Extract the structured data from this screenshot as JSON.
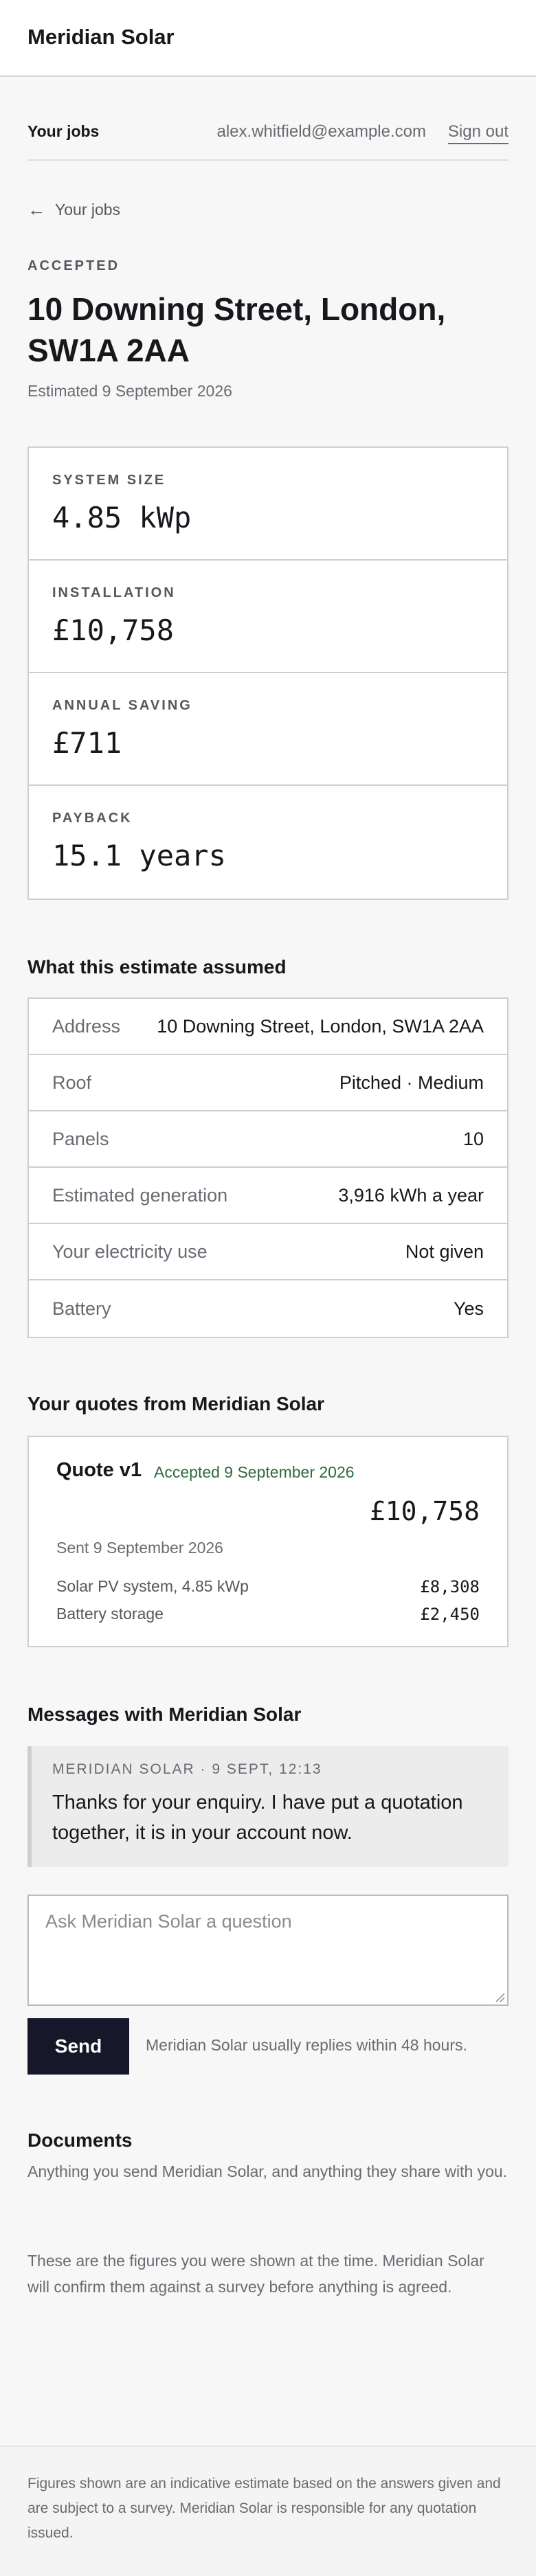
{
  "header": {
    "brand": "Meridian Solar"
  },
  "subnav": {
    "your_jobs": "Your jobs",
    "email": "alex.whitfield@example.com",
    "sign_out": "Sign out"
  },
  "back": {
    "label": "Your jobs"
  },
  "job": {
    "status": "ACCEPTED",
    "title": "10 Downing Street, London, SW1A 2AA",
    "estimated": "Estimated 9 September 2026"
  },
  "stats": [
    {
      "label": "SYSTEM SIZE",
      "value": "4.85 kWp"
    },
    {
      "label": "INSTALLATION",
      "value": "£10,758"
    },
    {
      "label": "ANNUAL SAVING",
      "value": "£711"
    },
    {
      "label": "PAYBACK",
      "value": "15.1 years"
    }
  ],
  "assumptions": {
    "heading": "What this estimate assumed",
    "rows": [
      {
        "label": "Address",
        "value": "10 Downing Street, London, SW1A 2AA"
      },
      {
        "label": "Roof",
        "value": "Pitched · Medium"
      },
      {
        "label": "Panels",
        "value": "10"
      },
      {
        "label": "Estimated generation",
        "value": "3,916 kWh a year"
      },
      {
        "label": "Your electricity use",
        "value": "Not given"
      },
      {
        "label": "Battery",
        "value": "Yes"
      }
    ]
  },
  "quotes": {
    "heading": "Your quotes from Meridian Solar",
    "items": [
      {
        "name": "Quote v1",
        "status": "Accepted 9 September 2026",
        "total": "£10,758",
        "sent": "Sent 9 September 2026",
        "lines": [
          {
            "label": "Solar PV system, 4.85 kWp",
            "amount": "£8,308"
          },
          {
            "label": "Battery storage",
            "amount": "£2,450"
          }
        ]
      }
    ]
  },
  "messages": {
    "heading": "Messages with Meridian Solar",
    "items": [
      {
        "meta": "MERIDIAN SOLAR · 9 SEPT, 12:13",
        "text": "Thanks for your enquiry. I have put a quotation together, it is in your account now."
      }
    ],
    "placeholder": "Ask Meridian Solar a question",
    "send_label": "Send",
    "reply_note": "Meridian Solar usually replies within 48 hours."
  },
  "documents": {
    "heading": "Documents",
    "description": "Anything you send Meridian Solar, and anything they share with you."
  },
  "figures_note": "These are the figures you were shown at the time. Meridian Solar will confirm them against a survey before anything is agreed.",
  "footer": {
    "text": "Figures shown are an indicative estimate based on the answers given and are subject to a survey. Meridian Solar is responsible for any quotation issued."
  }
}
